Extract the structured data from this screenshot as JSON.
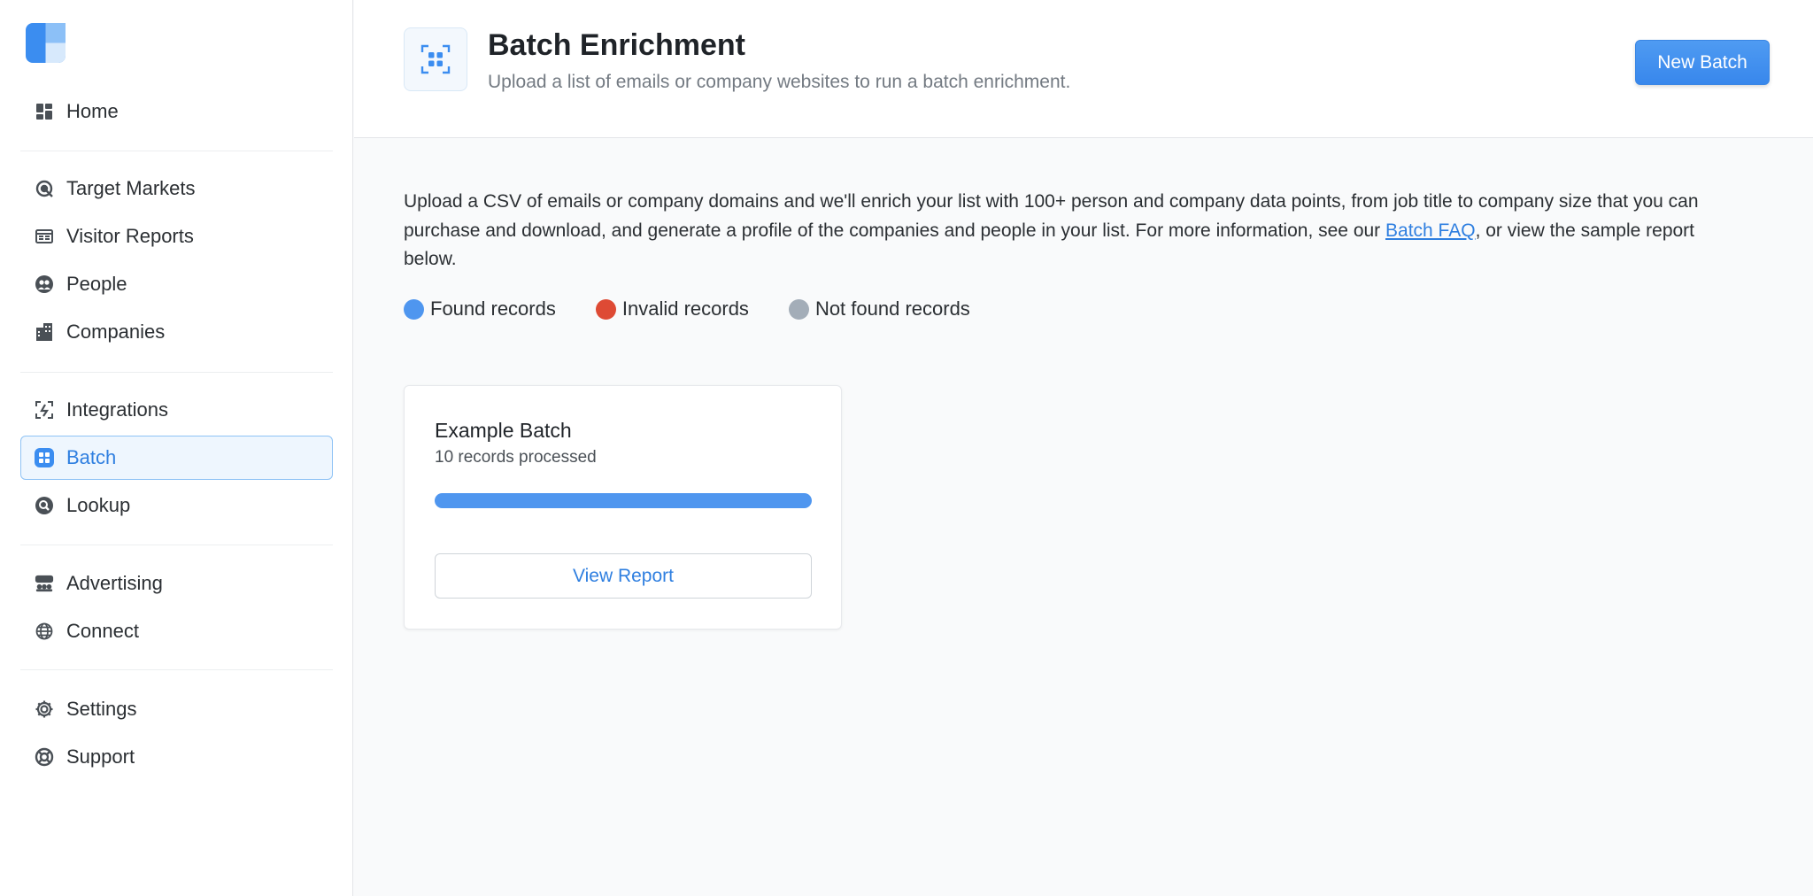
{
  "sidebar": {
    "groups": [
      [
        {
          "label": "Home",
          "icon": "dashboard-icon"
        }
      ],
      [
        {
          "label": "Target Markets",
          "icon": "target-icon"
        },
        {
          "label": "Visitor Reports",
          "icon": "report-icon"
        },
        {
          "label": "People",
          "icon": "people-icon"
        },
        {
          "label": "Companies",
          "icon": "building-icon"
        }
      ],
      [
        {
          "label": "Integrations",
          "icon": "integrations-icon"
        },
        {
          "label": "Batch",
          "icon": "batch-icon",
          "active": true
        },
        {
          "label": "Lookup",
          "icon": "lookup-icon"
        }
      ],
      [
        {
          "label": "Advertising",
          "icon": "advertising-icon"
        },
        {
          "label": "Connect",
          "icon": "globe-icon"
        }
      ],
      [
        {
          "label": "Settings",
          "icon": "gear-icon"
        },
        {
          "label": "Support",
          "icon": "lifebuoy-icon"
        }
      ]
    ]
  },
  "header": {
    "title": "Batch Enrichment",
    "subtitle": "Upload a list of emails or company websites to run a batch enrichment.",
    "new_batch_label": "New Batch"
  },
  "main": {
    "intro_before_link": "Upload a CSV of emails or company domains and we'll enrich your list with 100+ person and company data points, from job title to company size that you can purchase and download, and generate a profile of the companies and people in your list. For more information, see our ",
    "intro_link": "Batch FAQ",
    "intro_after_link": ", or view the sample report below.",
    "legend": [
      {
        "label": "Found records",
        "color": "#4f96ef"
      },
      {
        "label": "Invalid records",
        "color": "#de4a34"
      },
      {
        "label": "Not found records",
        "color": "#a3adb8"
      }
    ]
  },
  "card": {
    "title": "Example Batch",
    "subtitle": "10 records processed",
    "progress": {
      "found": 10,
      "invalid": 0,
      "not_found": 0
    },
    "view_report_label": "View Report"
  },
  "colors": {
    "accent": "#2f7fe0",
    "active_bg": "#eef6fe",
    "active_border": "#8ec2f5"
  }
}
